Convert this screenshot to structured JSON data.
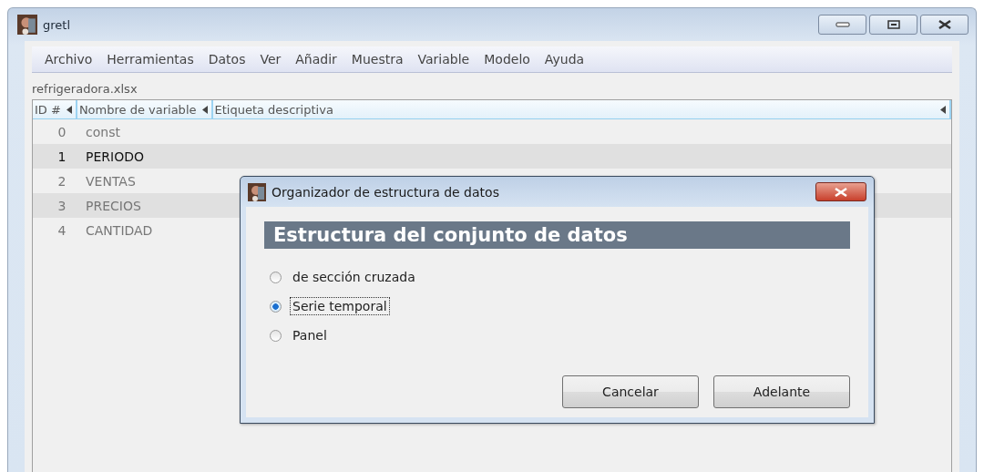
{
  "window": {
    "title": "gretl"
  },
  "menu": [
    {
      "label": "Archivo"
    },
    {
      "label": "Herramientas"
    },
    {
      "label": "Datos"
    },
    {
      "label": "Ver"
    },
    {
      "label": "Añadir"
    },
    {
      "label": "Muestra"
    },
    {
      "label": "Variable"
    },
    {
      "label": "Modelo"
    },
    {
      "label": "Ayuda"
    }
  ],
  "file_name": "refrigeradora.xlsx",
  "table": {
    "columns": [
      "ID #",
      "Nombre de variable",
      "Etiqueta descriptiva"
    ],
    "rows": [
      {
        "number": "0",
        "name": "const",
        "selected": false
      },
      {
        "number": "1",
        "name": "PERIODO",
        "selected": true
      },
      {
        "number": "2",
        "name": "VENTAS",
        "selected": false
      },
      {
        "number": "3",
        "name": "PRECIOS",
        "selected": false
      },
      {
        "number": "4",
        "name": "CANTIDAD",
        "selected": false
      }
    ]
  },
  "dialog": {
    "title": "Organizador de estructura de datos",
    "heading": "Estructura del conjunto de datos",
    "options": [
      {
        "label": "de sección cruzada",
        "selected": false
      },
      {
        "label": "Serie temporal",
        "selected": true
      },
      {
        "label": "Panel",
        "selected": false
      }
    ],
    "buttons": [
      {
        "label": "Cancelar"
      },
      {
        "label": "Adelante"
      }
    ]
  }
}
